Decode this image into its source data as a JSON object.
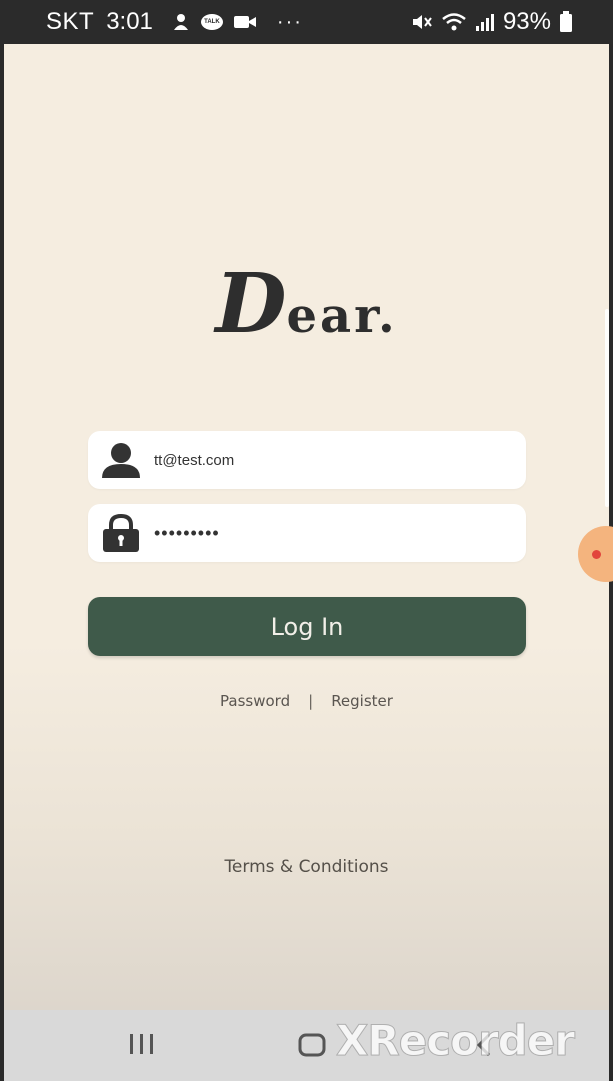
{
  "status_bar": {
    "carrier": "SKT",
    "time": "3:01",
    "battery": "93%",
    "talk_badge": "TALK",
    "overflow": "···"
  },
  "app": {
    "logo_initial": "D",
    "logo_rest": "ear.",
    "email_value": "tt@test.com",
    "password_value": "•••••••••",
    "login_label": "Log In",
    "password_link": "Password",
    "separator": "|",
    "register_link": "Register",
    "terms_link": "Terms & Conditions"
  },
  "nav_bar": {
    "watermark": "XRecorder"
  },
  "colors": {
    "background": "#f5ede0",
    "accent": "#3f5a4a"
  }
}
